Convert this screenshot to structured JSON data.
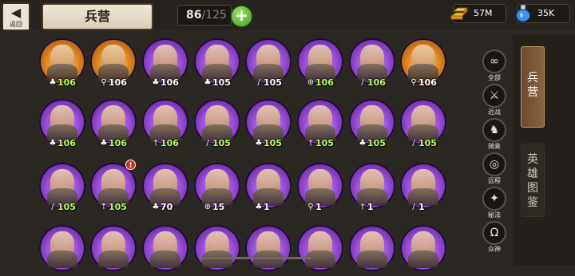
{
  "header": {
    "back_label": "返回",
    "title": "兵营",
    "count_current": "86",
    "count_max": "125",
    "plus_label": "+",
    "gold_value": "57M",
    "mana_value": "35K"
  },
  "colors": {
    "portrait_purple": "#9b4fd9",
    "portrait_orange": "#e38a23",
    "level_green": "#b7ff5a",
    "tab_active": "#8a6440"
  },
  "filters": [
    {
      "icon": "∞",
      "label": "全部",
      "icon_name": "all-icon"
    },
    {
      "icon": "⚔",
      "label": "近战",
      "icon_name": "melee-icon"
    },
    {
      "icon": "♞",
      "label": "骑乘",
      "icon_name": "mounted-icon"
    },
    {
      "icon": "◎",
      "label": "远程",
      "icon_name": "ranged-icon"
    },
    {
      "icon": "✦",
      "label": "秘法",
      "icon_name": "arcane-icon"
    },
    {
      "icon": "Ω",
      "label": "众神",
      "icon_name": "gods-icon"
    }
  ],
  "tabs": [
    {
      "label": "兵营",
      "active": true
    },
    {
      "label": "英雄图鉴",
      "active": false
    }
  ],
  "units": [
    {
      "level": "106",
      "role": "♣",
      "level_color": "green",
      "portrait": "orange",
      "alert": false
    },
    {
      "level": "106",
      "role": "⚲",
      "level_color": "white",
      "portrait": "orange",
      "alert": false
    },
    {
      "level": "106",
      "role": "♣",
      "level_color": "white",
      "portrait": "purple",
      "alert": false
    },
    {
      "level": "105",
      "role": "♣",
      "level_color": "white",
      "portrait": "purple",
      "alert": false
    },
    {
      "level": "105",
      "role": "/",
      "level_color": "white",
      "portrait": "purple",
      "alert": false
    },
    {
      "level": "106",
      "role": "⊕",
      "level_color": "green",
      "portrait": "purple",
      "alert": false
    },
    {
      "level": "106",
      "role": "/",
      "level_color": "green",
      "portrait": "purple",
      "alert": false
    },
    {
      "level": "106",
      "role": "⚲",
      "level_color": "white",
      "portrait": "orange",
      "alert": false
    },
    {
      "level": "106",
      "role": "♣",
      "level_color": "green",
      "portrait": "purple",
      "alert": false
    },
    {
      "level": "106",
      "role": "♣",
      "level_color": "green",
      "portrait": "purple",
      "alert": false
    },
    {
      "level": "106",
      "role": "†",
      "level_color": "green",
      "portrait": "purple",
      "alert": false
    },
    {
      "level": "105",
      "role": "/",
      "level_color": "green",
      "portrait": "purple",
      "alert": false
    },
    {
      "level": "105",
      "role": "♣",
      "level_color": "green",
      "portrait": "purple",
      "alert": false
    },
    {
      "level": "105",
      "role": "†",
      "level_color": "green",
      "portrait": "purple",
      "alert": false
    },
    {
      "level": "105",
      "role": "♣",
      "level_color": "green",
      "portrait": "purple",
      "alert": false
    },
    {
      "level": "105",
      "role": "/",
      "level_color": "green",
      "portrait": "purple",
      "alert": false
    },
    {
      "level": "105",
      "role": "/",
      "level_color": "green",
      "portrait": "purple",
      "alert": false
    },
    {
      "level": "105",
      "role": "↑",
      "level_color": "green",
      "portrait": "purple",
      "alert": true
    },
    {
      "level": "70",
      "role": "♣",
      "level_color": "white",
      "portrait": "purple",
      "alert": false
    },
    {
      "level": "15",
      "role": "⊕",
      "level_color": "white",
      "portrait": "purple",
      "alert": false
    },
    {
      "level": "1",
      "role": "♣",
      "level_color": "white",
      "portrait": "purple",
      "alert": false
    },
    {
      "level": "1",
      "role": "⚲",
      "level_color": "white",
      "portrait": "purple",
      "alert": false
    },
    {
      "level": "1",
      "role": "†",
      "level_color": "white",
      "portrait": "purple",
      "alert": false
    },
    {
      "level": "1",
      "role": "/",
      "level_color": "white",
      "portrait": "purple",
      "alert": false
    },
    {
      "level": "",
      "role": "",
      "level_color": "white",
      "portrait": "purple",
      "alert": false
    },
    {
      "level": "",
      "role": "",
      "level_color": "white",
      "portrait": "purple",
      "alert": false
    },
    {
      "level": "",
      "role": "",
      "level_color": "white",
      "portrait": "purple",
      "alert": false
    },
    {
      "level": "",
      "role": "",
      "level_color": "white",
      "portrait": "purple",
      "alert": false
    },
    {
      "level": "",
      "role": "",
      "level_color": "white",
      "portrait": "purple",
      "alert": false
    },
    {
      "level": "",
      "role": "",
      "level_color": "white",
      "portrait": "purple",
      "alert": false
    },
    {
      "level": "",
      "role": "",
      "level_color": "white",
      "portrait": "purple",
      "alert": false
    },
    {
      "level": "",
      "role": "",
      "level_color": "white",
      "portrait": "purple",
      "alert": false
    }
  ]
}
